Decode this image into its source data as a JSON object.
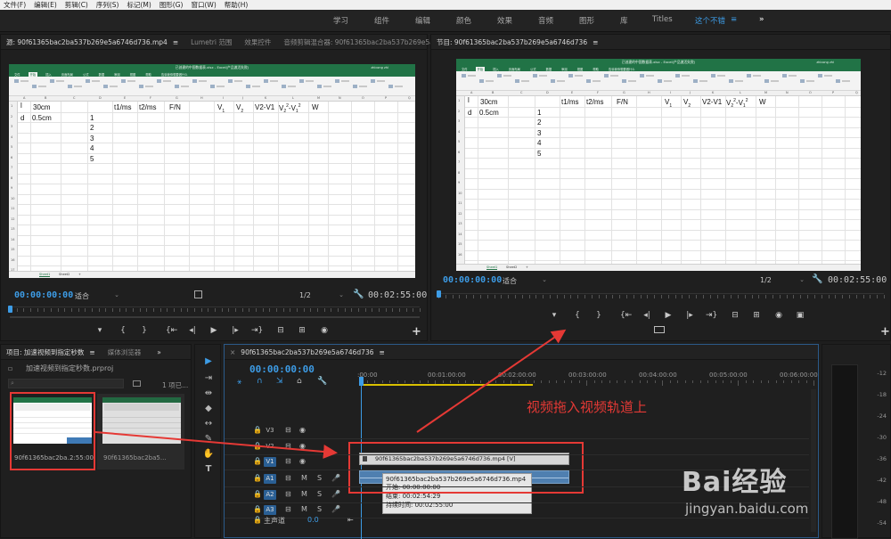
{
  "menu": [
    "文件(F)",
    "编辑(E)",
    "剪辑(C)",
    "序列(S)",
    "标记(M)",
    "图形(G)",
    "窗口(W)",
    "帮助(H)"
  ],
  "workspaces": [
    "学习",
    "组件",
    "编辑",
    "颜色",
    "效果",
    "音频",
    "图形",
    "库",
    "Titles",
    "这个不错",
    "≡",
    "»"
  ],
  "source_panel": {
    "tab_source": "源: 90f61365bac2ba537b269e5a6746d736.mp4",
    "tab_menu": "≡",
    "tab_lumetri": "Lumetri 范围",
    "tab_effect_controls": "效果控件",
    "tab_audio_mixer": "音频剪辑混合器: 90f61365bac2ba537b269e5a6",
    "overflow": "»",
    "timecode_in": "00:00:00:00",
    "fit": "适合",
    "resolution": "1/2",
    "timecode_dur": "00:02:55:00"
  },
  "program_panel": {
    "tab": "节目: 90f61365bac2ba537b269e5a6746d736",
    "tab_menu": "≡",
    "timecode_in": "00:00:00:00",
    "fit": "适合",
    "resolution": "1/2",
    "timecode_dur": "00:02:55:00"
  },
  "excel": {
    "title": "已创建的中国数据表.xlsx - Excel(产品激活失败)",
    "user": "zhicong zhi",
    "tabs": [
      "文件",
      "开始",
      "插入",
      "页面布局",
      "公式",
      "数据",
      "审阅",
      "视图",
      "帮助",
      "告诉我你想要做什么"
    ],
    "col_headers": [
      "A",
      "B",
      "C",
      "D",
      "E",
      "F",
      "G",
      "H",
      "I",
      "J",
      "K",
      "L",
      "M",
      "N",
      "O",
      "P",
      "Q",
      "R"
    ],
    "row_headers": [
      "1",
      "2",
      "3",
      "4",
      "5",
      "6",
      "7",
      "8",
      "9",
      "10",
      "11",
      "12",
      "13",
      "14",
      "15",
      "16",
      "17"
    ],
    "r1": {
      "a": "l",
      "b": "30cm",
      "e": "t1/ms",
      "f": "t2/ms",
      "g": "F/N",
      "v1": "V",
      "v1s": "1",
      "v2": "V",
      "v2s": "2",
      "v2v1": "V2-V1",
      "sq_a": "V",
      "sq_as": "2",
      "sq_ap": "2",
      "sq_b": "-V",
      "sq_bs": "1",
      "sq_bp": "2",
      "w": "W"
    },
    "r2": {
      "a": "d",
      "b": "0.5cm",
      "d": "1"
    },
    "dcol": [
      "2",
      "3",
      "4",
      "5"
    ],
    "sheets": [
      "Sheet1",
      "Sheet2",
      "+"
    ]
  },
  "project_panel": {
    "tab": "项目: 加速视频到指定秒数",
    "tab_menu": "≡",
    "tab_media": "媒体浏览器",
    "overflow": "»",
    "file": "加速视频到指定秒数.prproj",
    "count": "1 项已...",
    "items": [
      {
        "name": "90f61365bac2ba...",
        "dur": "2:55:00"
      },
      {
        "name": "90f61365bac2ba5...",
        "dur": ""
      }
    ]
  },
  "timeline": {
    "close": "×",
    "tab": "90f61365bac2ba537b269e5a6746d736",
    "tab_menu": "≡",
    "timecode": "00:00:00:00",
    "ruler": [
      ":00:00",
      "00:01:00:00",
      "00:02:00:00",
      "00:03:00:00",
      "00:04:00:00",
      "00:05:00:00",
      "00:06:00:00"
    ],
    "tracks": [
      {
        "id": "V3",
        "kind": "video"
      },
      {
        "id": "V2",
        "kind": "video"
      },
      {
        "id": "V1",
        "kind": "video"
      },
      {
        "id": "A1",
        "kind": "audio"
      },
      {
        "id": "A2",
        "kind": "audio"
      },
      {
        "id": "A3",
        "kind": "audio"
      }
    ],
    "track_toggles": {
      "m": "M",
      "s": "S"
    },
    "master": "主声道",
    "master_val": "0.0",
    "video_clip": "90f61365bac2ba537b269e5a6746d736.mp4 [V]",
    "audio_clip": "90f61365bac2ba537b269e5a6746d736.mp4",
    "tooltip": {
      "start": "开始: 00:00:00:00",
      "end": "结束: 00:02:54:29",
      "dur": "持续时间: 00:02:55:00"
    }
  },
  "meter": {
    "labels": [
      "-12",
      "-18",
      "-24",
      "-30",
      "-36",
      "-42",
      "-48",
      "-54"
    ]
  },
  "annotation": "视频拖入视频轨道上",
  "watermark": {
    "brand": "Bai经验",
    "url": "jingyan.baidu.com"
  },
  "colors": {
    "accent": "#3d9ce6",
    "annotation": "#e53935",
    "excel_green": "#217346",
    "clip_audio": "#4f7fb0"
  }
}
